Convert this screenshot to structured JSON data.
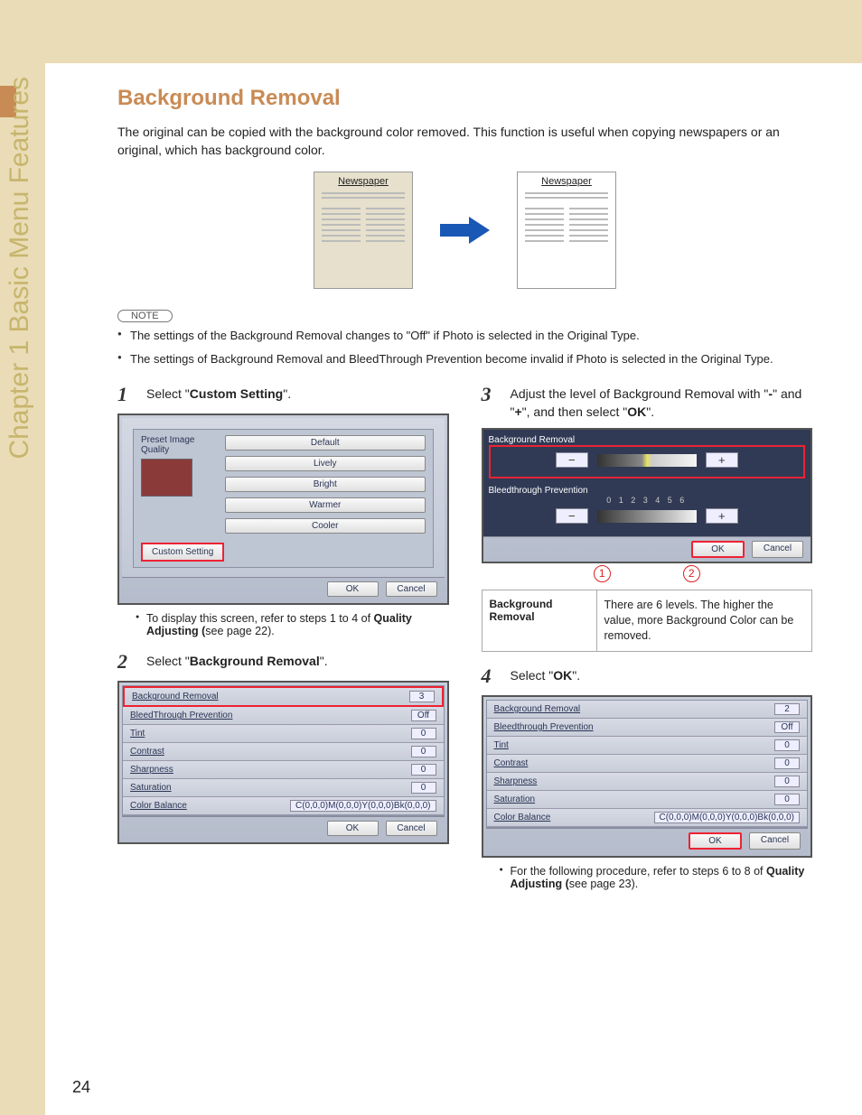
{
  "header": {
    "chapter": "Chapter 1  Basic Menu Features",
    "title": "Background Removal",
    "intro": "The original can be copied with the background color removed. This function is useful when copying newspapers or an original, which has background color.",
    "newspaper_label": "Newspaper"
  },
  "note": {
    "label": "NOTE",
    "items": [
      "The settings of the Background Removal changes to \"Off\" if Photo is selected in the Original Type.",
      "The settings of Background Removal and BleedThrough Prevention become invalid if Photo is selected in the Original Type."
    ]
  },
  "steps": {
    "s1": {
      "num": "1",
      "text_a": "Select \"",
      "bold": "Custom Setting",
      "text_b": "\".",
      "sub_a": "To display this screen, refer to steps 1 to 4 of ",
      "sub_b": "Quality Adjusting (",
      "sub_c": "see page 22)."
    },
    "s2": {
      "num": "2",
      "text_a": "Select \"",
      "bold": "Background Removal",
      "text_b": "\"."
    },
    "s3": {
      "num": "3",
      "text_a": "Adjust the level of Background Removal with \"",
      "bold_minus": "-",
      "mid": "\" and \"",
      "bold_plus": "+",
      "text_b": "\", and then select \"",
      "bold_ok": "OK",
      "tail": "\"."
    },
    "s4": {
      "num": "4",
      "text_a": "Select \"",
      "bold": "OK",
      "text_b": "\".",
      "sub_a": "For the following procedure, refer to steps 6 to 8 of ",
      "sub_b": "Quality Adjusting (",
      "sub_c": "see page 23)."
    }
  },
  "screenshot1": {
    "title": "Preset Image Quality",
    "buttons": [
      "Default",
      "Lively",
      "Bright",
      "Warmer",
      "Cooler"
    ],
    "custom": "Custom Setting",
    "ok": "OK",
    "cancel": "Cancel"
  },
  "screenshot2": {
    "rows": [
      {
        "name": "Background Removal",
        "val": "3",
        "sel": true
      },
      {
        "name": "BleedThrough Prevention",
        "val": "Off"
      },
      {
        "name": "Tint",
        "val": "0"
      },
      {
        "name": "Contrast",
        "val": "0"
      },
      {
        "name": "Sharpness",
        "val": "0"
      },
      {
        "name": "Saturation",
        "val": "0"
      },
      {
        "name": "Color Balance",
        "val": "C(0,0,0)M(0,0,0)Y(0,0,0)Bk(0,0,0)"
      }
    ],
    "ok": "OK",
    "cancel": "Cancel"
  },
  "screenshot3": {
    "sec1": "Background Removal",
    "sec2": "Bleedthrough Prevention",
    "scale": "0 1 2 3 4 5 6",
    "minus": "−",
    "plus": "+",
    "ok": "OK",
    "cancel": "Cancel"
  },
  "screenshot4": {
    "rows": [
      {
        "name": "Background Removal",
        "val": "2"
      },
      {
        "name": "Bleedthrough Prevention",
        "val": "Off"
      },
      {
        "name": "Tint",
        "val": "0"
      },
      {
        "name": "Contrast",
        "val": "0"
      },
      {
        "name": "Sharpness",
        "val": "0"
      },
      {
        "name": "Saturation",
        "val": "0"
      },
      {
        "name": "Color Balance",
        "val": "C(0,0,0)M(0,0,0)Y(0,0,0)Bk(0,0,0)"
      }
    ],
    "ok": "OK",
    "cancel": "Cancel"
  },
  "callout": {
    "one": "1",
    "two": "2"
  },
  "info": {
    "l1": "Background",
    "l2": "Removal",
    "r": "There are 6 levels. The higher the value, more Background Color can be removed."
  },
  "page_number": "24"
}
